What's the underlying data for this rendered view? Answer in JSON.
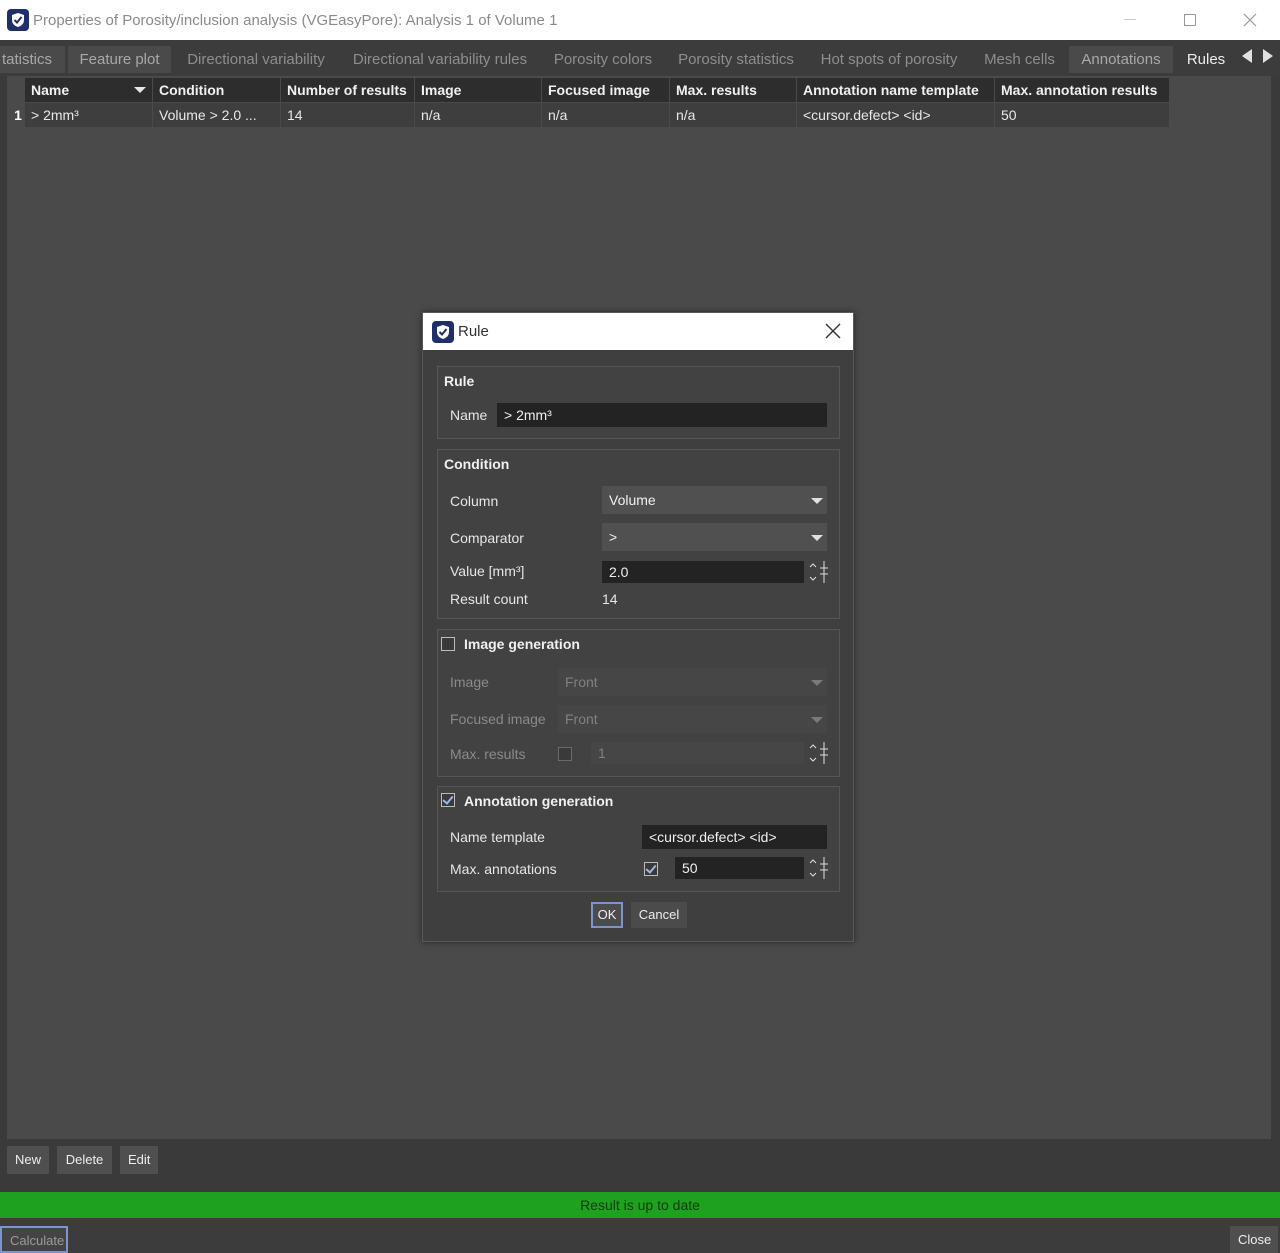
{
  "window": {
    "title": "Properties of Porosity/inclusion analysis (VGEasyPore): Analysis 1 of Volume 1"
  },
  "tabs": [
    {
      "label": "tatistics"
    },
    {
      "label": "Feature plot"
    },
    {
      "label": "Directional variability"
    },
    {
      "label": "Directional variability rules"
    },
    {
      "label": "Porosity colors"
    },
    {
      "label": "Porosity statistics"
    },
    {
      "label": "Hot spots of porosity"
    },
    {
      "label": "Mesh cells"
    },
    {
      "label": "Annotations"
    },
    {
      "label": "Rules"
    }
  ],
  "table": {
    "columns": [
      "Name",
      "Condition",
      "Number of results",
      "Image",
      "Focused image",
      "Max. results",
      "Annotation name template",
      "Max. annotation results"
    ],
    "rows": [
      {
        "index": "1",
        "name": "> 2mm³",
        "condition": "Volume > 2.0 ...",
        "number_of_results": "14",
        "image": "n/a",
        "focused_image": "n/a",
        "max_results": "n/a",
        "annotation_name_template": "<cursor.defect> <id>",
        "max_annotation_results": "50"
      }
    ]
  },
  "actions": {
    "new": "New",
    "delete": "Delete",
    "edit": "Edit"
  },
  "status": {
    "text": "Result is up to date",
    "color": "#1ea11e"
  },
  "footer": {
    "calculate": "Calculate",
    "close": "Close"
  },
  "dialog": {
    "title": "Rule",
    "rule_group": {
      "title": "Rule",
      "name_label": "Name",
      "name_value": "> 2mm³"
    },
    "condition_group": {
      "title": "Condition",
      "column_label": "Column",
      "column_value": "Volume",
      "comparator_label": "Comparator",
      "comparator_value": ">",
      "value_label": "Value [mm³]",
      "value_value": "2.0",
      "result_count_label": "Result count",
      "result_count_value": "14"
    },
    "image_group": {
      "title": "Image generation",
      "checked": false,
      "image_label": "Image",
      "image_value": "Front",
      "focused_label": "Focused image",
      "focused_value": "Front",
      "max_results_label": "Max. results",
      "max_results_checked": false,
      "max_results_value": "1"
    },
    "annotation_group": {
      "title": "Annotation generation",
      "checked": true,
      "name_template_label": "Name template",
      "name_template_value": "<cursor.defect> <id>",
      "max_annotations_label": "Max. annotations",
      "max_annotations_checked": true,
      "max_annotations_value": "50"
    },
    "ok": "OK",
    "cancel": "Cancel"
  }
}
